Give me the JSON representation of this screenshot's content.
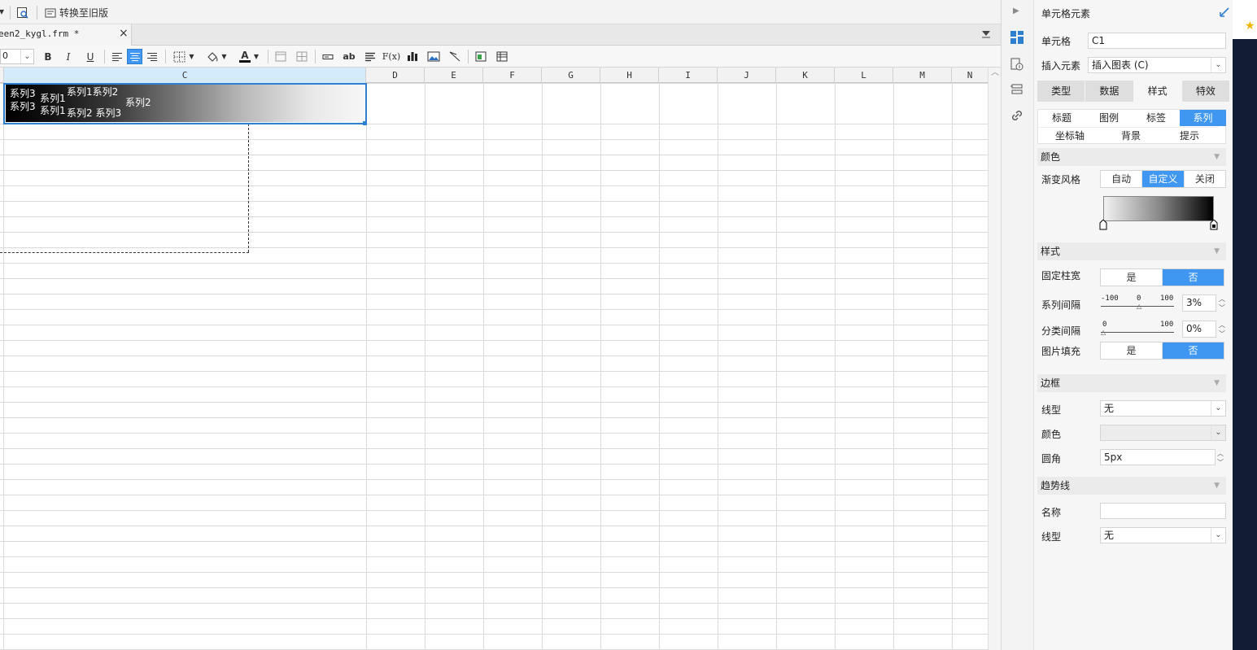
{
  "topbar": {
    "convert_label": "转换至旧版"
  },
  "tab": {
    "filename": "een2_kygl.frm *",
    "close": "×"
  },
  "toolbar": {
    "font_size": "0",
    "bold": "B",
    "italic": "I",
    "underline": "U",
    "text_ab": "ab",
    "formula": "F(x)",
    "font_color_label": "A",
    "accent": "#3f97f1"
  },
  "columns": [
    "C",
    "D",
    "E",
    "F",
    "G",
    "H",
    "I",
    "J",
    "K",
    "L",
    "M",
    "N"
  ],
  "chart": {
    "labels_top_left": [
      "系列3",
      "系列3"
    ],
    "labels_mid": [
      "系列1",
      "系列1"
    ],
    "labels_cluster_top": "系列1系列2",
    "labels_cluster_bottom": "系列2 系列3",
    "label_right": "系列2"
  },
  "panel": {
    "title": "单元格元素",
    "cell_label": "单元格",
    "cell_value": "C1",
    "insert_label": "插入元素",
    "insert_value": "插入图表 (C)",
    "main_tabs": [
      "类型",
      "数据",
      "样式",
      "特效"
    ],
    "main_tab_active": "样式",
    "sub_tabs_row1": [
      "标题",
      "图例",
      "标签",
      "系列"
    ],
    "sub_tabs_row2": [
      "坐标轴",
      "背景",
      "提示"
    ],
    "sub_tab_active": "系列",
    "color_section": "颜色",
    "gradient_label": "渐变风格",
    "gradient_options": [
      "自动",
      "自定义",
      "关闭"
    ],
    "gradient_active": "自定义",
    "style_section": "样式",
    "fixed_width_label": "固定柱宽",
    "yes": "是",
    "no": "否",
    "series_gap_label": "系列间隔",
    "series_gap_min": "-100",
    "series_gap_mid": "0",
    "series_gap_max": "100",
    "series_gap_value": "3%",
    "category_gap_label": "分类间隔",
    "category_gap_min": "0",
    "category_gap_max": "100",
    "category_gap_value": "0%",
    "image_fill_label": "图片填充",
    "border_section": "边框",
    "line_type_label": "线型",
    "line_type_value": "无",
    "border_color_label": "颜色",
    "radius_label": "圆角",
    "radius_value": "5px",
    "trend_section": "趋势线",
    "trend_name_label": "名称",
    "trend_line_label": "线型",
    "trend_line_value": "无"
  }
}
